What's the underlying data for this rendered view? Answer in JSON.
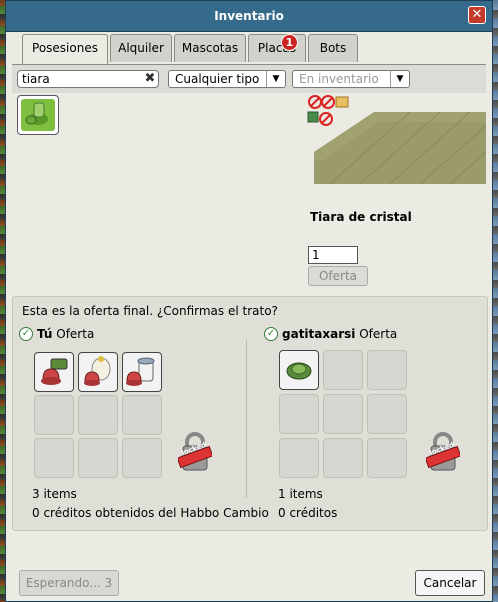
{
  "window": {
    "title": "Inventario",
    "close_glyph": "✕"
  },
  "tabs": [
    {
      "label": "Posesiones",
      "active": true
    },
    {
      "label": "Alquiler"
    },
    {
      "label": "Mascotas"
    },
    {
      "label": "Placas",
      "badge": "1"
    },
    {
      "label": "Bots"
    }
  ],
  "filters": {
    "search_value": "tiara",
    "type_select": "Cualquier tipo",
    "location_select": "En inventario"
  },
  "selected_item": {
    "name": "Tiara de cristal",
    "quantity": "1",
    "offer_label": "Oferta"
  },
  "trade": {
    "header": "Esta es la oferta final. ¿Confirmas el trato?",
    "you": {
      "name": "Tú",
      "offer_word": "Oferta",
      "items_count": "3 items",
      "credits": "0 créditos obtenidos del Habbo Cambio",
      "locked_label": "locked"
    },
    "other": {
      "name": "gatitaxarsi",
      "offer_word": "Oferta",
      "items_count": "1 items",
      "credits": "0 créditos",
      "locked_label": "locked"
    }
  },
  "buttons": {
    "waiting": "Esperando... 3",
    "cancel": "Cancelar"
  },
  "colors": {
    "titlebar": "#356a8a",
    "accent_green": "#7fbf3f",
    "badge_red": "#cc2222"
  }
}
